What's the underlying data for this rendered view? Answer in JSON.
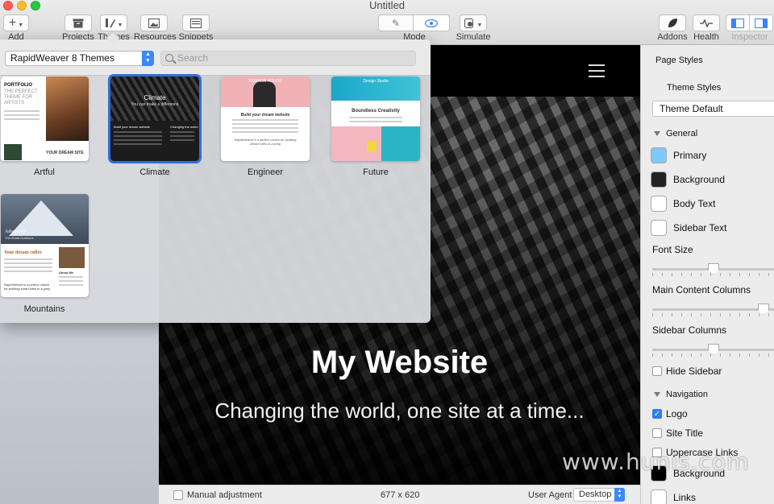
{
  "window": {
    "title": "Untitled"
  },
  "toolbar": {
    "add": "Add",
    "projects": "Projects",
    "themes": "Themes",
    "resources": "Resources",
    "snippets": "Snippets",
    "mode": "Mode",
    "simulate": "Simulate",
    "addons": "Addons",
    "health": "Health",
    "inspector": "Inspector"
  },
  "popover": {
    "theme_set": "RapidWeaver 8 Themes",
    "search_placeholder": "Search",
    "themes": [
      {
        "name": "Artful",
        "title": "PORTFOLIO",
        "sub": "THE PERFECT THEME FOR ARTISTS",
        "tag": "YOUR DREAM SITE"
      },
      {
        "name": "Climate",
        "title": "Climate",
        "sub": "You can make a difference",
        "tag": "Build your dream website",
        "tag2": "Changing the world"
      },
      {
        "name": "Engineer",
        "title": "FASHION HOUSE",
        "sub": "Build your dream website",
        "tag": "RapidWeaver's a perfect choice for building vibrant sites in a jump"
      },
      {
        "name": "Future",
        "title": "Design Studio",
        "sub": "Boundless Creativity"
      },
      {
        "name": "Mountains",
        "title": "Adventure",
        "sub": "The Great Outdoors",
        "tag": "Your dream coffee",
        "tag2": "About Me",
        "tag3": "RapidWeaver's a perfect choice for building smart sites in a jump"
      }
    ]
  },
  "site": {
    "title": "My Website",
    "subtitle": "Changing the world, one site at a time..."
  },
  "status": {
    "manual_adjustment": "Manual adjustment",
    "size": "677 x 620",
    "user_agent_label": "User Agent",
    "user_agent_value": "Desktop"
  },
  "inspector": {
    "page_styles": "Page Styles",
    "theme_styles": "Theme Styles",
    "theme_default": "Theme Default",
    "general": "General",
    "colors": [
      {
        "label": "Primary",
        "color": "#7ec9f7"
      },
      {
        "label": "Background",
        "color": "#222222"
      },
      {
        "label": "Body Text",
        "color": "#ffffff"
      },
      {
        "label": "Sidebar Text",
        "color": "#ffffff"
      }
    ],
    "font_size": "Font Size",
    "main_content_columns": "Main Content Columns",
    "sidebar_columns": "Sidebar Columns",
    "sliders": {
      "font_size": 0.5,
      "main_content_columns": 0.95,
      "sidebar_columns": 0.5
    },
    "hide_sidebar": "Hide Sidebar",
    "navigation": "Navigation",
    "logo": "Logo",
    "site_title": "Site Title",
    "uppercase_links": "Uppercase Links",
    "nav_background": "Background",
    "nav_background_color": "#000000",
    "links": "Links",
    "links_color": "#ffffff"
  },
  "watermark": "www.hunis.com"
}
